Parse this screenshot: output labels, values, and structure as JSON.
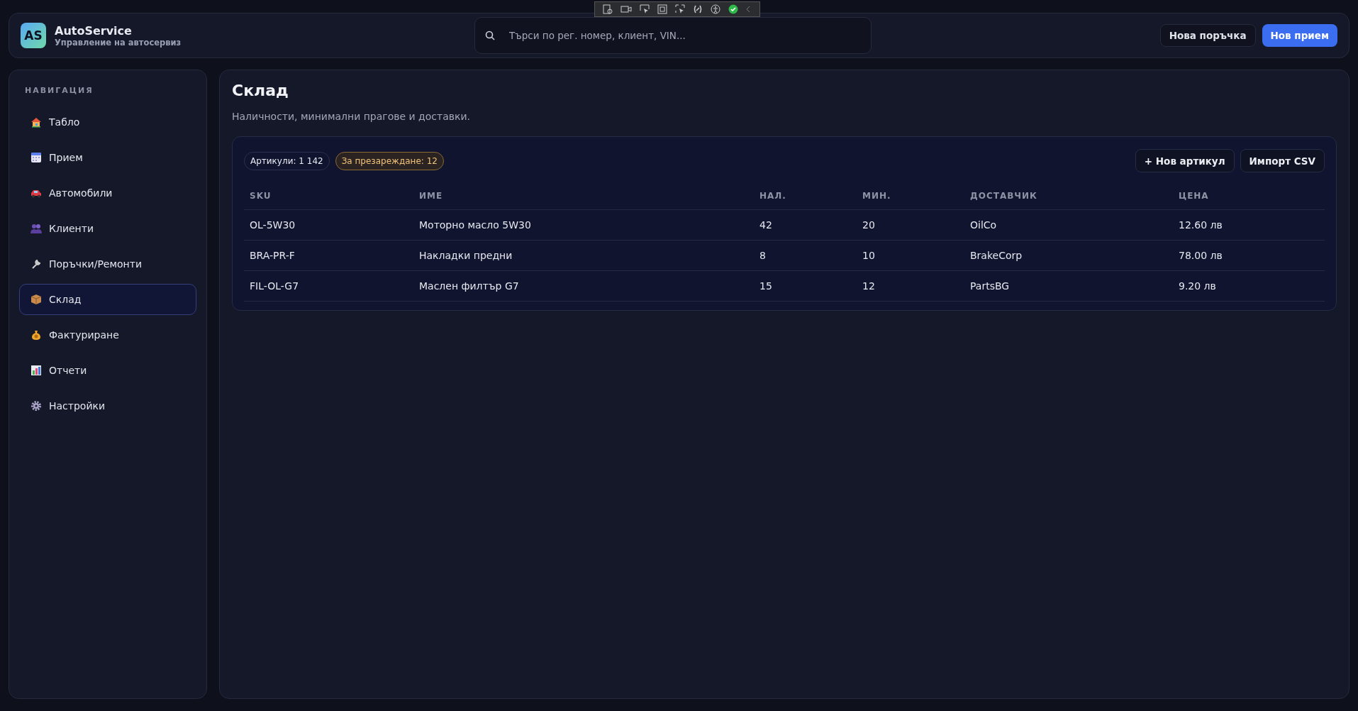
{
  "header": {
    "logo": "AS",
    "app_name": "AutoService",
    "subtitle": "Управление на автосервиз",
    "search": {
      "placeholder": "Търси по рег. номер, клиент, VIN..."
    },
    "buttons": [
      {
        "label": "Нова поръчка",
        "kind": "secondary"
      },
      {
        "label": "Нов прием",
        "kind": "primary"
      }
    ]
  },
  "sidebar": {
    "heading": "НАВИГАЦИЯ",
    "items": [
      {
        "label": "Табло",
        "selected": false
      },
      {
        "label": "Прием",
        "selected": false
      },
      {
        "label": "Автомобили",
        "selected": false
      },
      {
        "label": "Клиенти",
        "selected": false
      },
      {
        "label": "Поръчки/Ремонти",
        "selected": false
      },
      {
        "label": "Склад",
        "selected": true
      },
      {
        "label": "Фактуриране",
        "selected": false
      },
      {
        "label": "Отчети",
        "selected": false
      },
      {
        "label": "Настройки",
        "selected": false
      }
    ]
  },
  "page": {
    "title": "Склад",
    "subtitle": "Наличности, минимални прагове и доставки."
  },
  "inventory": {
    "badges": [
      {
        "label": "Артикули: 1 142",
        "kind": "neutral"
      },
      {
        "label": "За презареждане: 12",
        "kind": "warning"
      }
    ],
    "actions": [
      "+ Нов артикул",
      "Импорт CSV"
    ],
    "columns": [
      "SKU",
      "ИМЕ",
      "НАЛ.",
      "МИН.",
      "ДОСТАВЧИК",
      "ЦЕНА"
    ],
    "rows": [
      [
        "OL-5W30",
        "Моторно масло 5W30",
        "42",
        "20",
        "OilCo",
        "12.60 лв"
      ],
      [
        "BRA-PR-F",
        "Накладки предни",
        "8",
        "10",
        "BrakeCorp",
        "78.00 лв"
      ],
      [
        "FIL-OL-G7",
        "Маслен филтър G7",
        "15",
        "12",
        "PartsBG",
        "9.20 лв"
      ]
    ]
  }
}
